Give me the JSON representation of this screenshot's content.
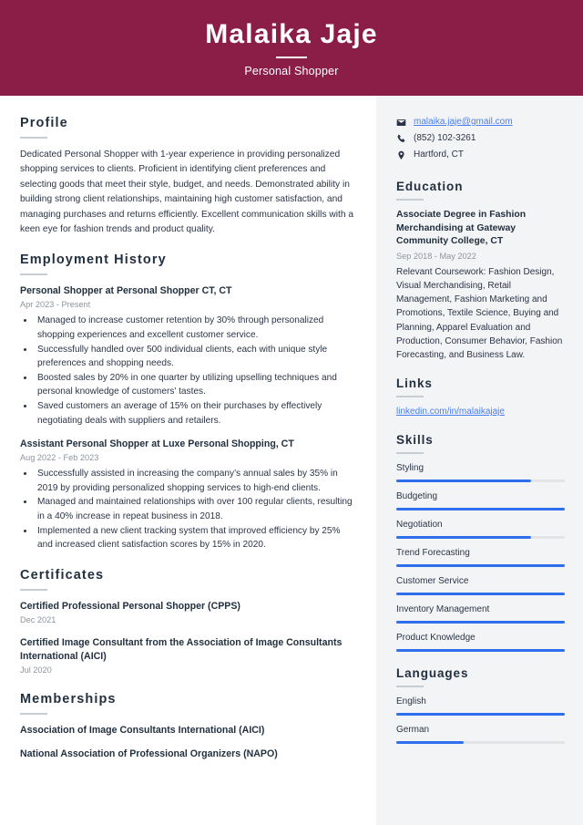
{
  "header": {
    "name": "Malaika Jaje",
    "role": "Personal Shopper",
    "bg_color": "#8b1e46"
  },
  "accent_color": "#2f6fed",
  "link_color": "#4a7ef0",
  "main": {
    "profile": {
      "heading": "Profile",
      "text": "Dedicated Personal Shopper with 1-year experience in providing personalized shopping services to clients. Proficient in identifying client preferences and selecting goods that meet their style, budget, and needs. Demonstrated ability in building strong client relationships, maintaining high customer satisfaction, and managing purchases and returns efficiently. Excellent communication skills with a keen eye for fashion trends and product quality."
    },
    "employment": {
      "heading": "Employment History",
      "entries": [
        {
          "title": "Personal Shopper at Personal Shopper CT, CT",
          "date": "Apr 2023 - Present",
          "bullets": [
            "Managed to increase customer retention by 30% through personalized shopping experiences and excellent customer service.",
            "Successfully handled over 500 individual clients, each with unique style preferences and shopping needs.",
            "Boosted sales by 20% in one quarter by utilizing upselling techniques and personal knowledge of customers' tastes.",
            "Saved customers an average of 15% on their purchases by effectively negotiating deals with suppliers and retailers."
          ]
        },
        {
          "title": "Assistant Personal Shopper at Luxe Personal Shopping, CT",
          "date": "Aug 2022 - Feb 2023",
          "bullets": [
            "Successfully assisted in increasing the company’s annual sales by 35% in 2019 by providing personalized shopping services to high-end clients.",
            "Managed and maintained relationships with over 100 regular clients, resulting in a 40% increase in repeat business in 2018.",
            "Implemented a new client tracking system that improved efficiency by 25% and increased client satisfaction scores by 15% in 2020."
          ]
        }
      ]
    },
    "certificates": {
      "heading": "Certificates",
      "entries": [
        {
          "title": "Certified Professional Personal Shopper (CPPS)",
          "date": "Dec 2021"
        },
        {
          "title": "Certified Image Consultant from the Association of Image Consultants International (AICI)",
          "date": "Jul 2020"
        }
      ]
    },
    "memberships": {
      "heading": "Memberships",
      "entries": [
        {
          "title": "Association of Image Consultants International (AICI)"
        },
        {
          "title": "National Association of Professional Organizers (NAPO)"
        }
      ]
    }
  },
  "side": {
    "contact": [
      {
        "icon": "envelope-icon",
        "text": "malaika.jaje@gmail.com",
        "is_link": true
      },
      {
        "icon": "phone-icon",
        "text": "(852) 102-3261",
        "is_link": false
      },
      {
        "icon": "location-pin-icon",
        "text": "Hartford, CT",
        "is_link": false
      }
    ],
    "education": {
      "heading": "Education",
      "entries": [
        {
          "title": "Associate Degree in Fashion Merchandising at Gateway Community College, CT",
          "date": "Sep 2018 - May 2022",
          "description": "Relevant Coursework: Fashion Design, Visual Merchandising, Retail Management, Fashion Marketing and Promotions, Textile Science, Buying and Planning, Apparel Evaluation and Production, Consumer Behavior, Fashion Forecasting, and Business Law."
        }
      ]
    },
    "links": {
      "heading": "Links",
      "items": [
        {
          "text": "linkedin.com/in/malaikajaje"
        }
      ]
    },
    "skills": {
      "heading": "Skills",
      "items": [
        {
          "label": "Styling",
          "level": 80
        },
        {
          "label": "Budgeting",
          "level": 100
        },
        {
          "label": "Negotiation",
          "level": 80
        },
        {
          "label": "Trend Forecasting",
          "level": 100
        },
        {
          "label": "Customer Service",
          "level": 100
        },
        {
          "label": "Inventory Management",
          "level": 100
        },
        {
          "label": "Product Knowledge",
          "level": 100
        }
      ]
    },
    "languages": {
      "heading": "Languages",
      "items": [
        {
          "label": "English",
          "level": 100
        },
        {
          "label": "German",
          "level": 40
        }
      ]
    }
  }
}
